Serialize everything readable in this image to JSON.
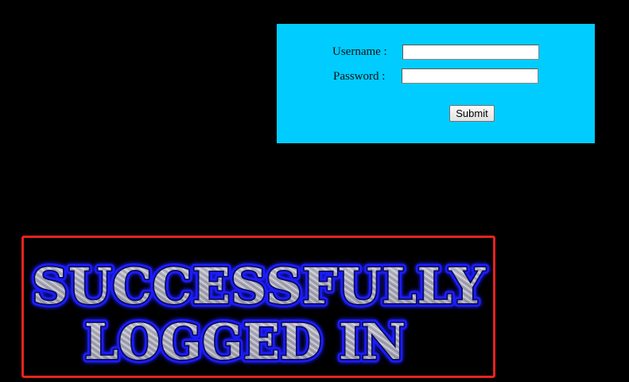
{
  "login_form": {
    "panel_color": "#00ccff",
    "username_label": "Username :",
    "password_label": "Password :",
    "username_value": "",
    "password_value": "",
    "submit_label": "Submit"
  },
  "success_banner": {
    "line1": "SUCCESSFULLY",
    "line2": "LOGGED IN",
    "border_color": "#e8231f",
    "glow_color": "#1a1aff",
    "text_color": "#b8b8c4"
  }
}
